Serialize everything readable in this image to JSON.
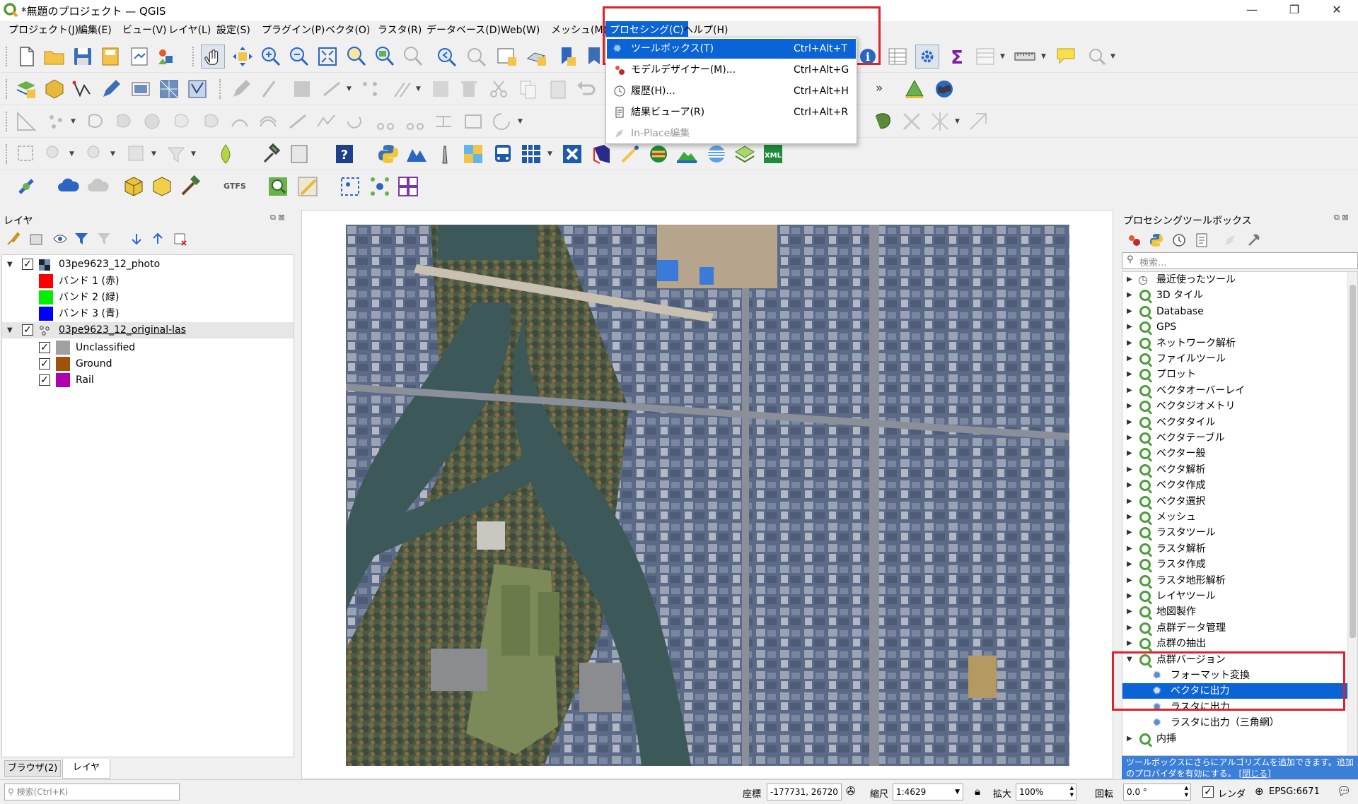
{
  "window": {
    "title": "*無題のプロジェクト — QGIS",
    "minimize": "—",
    "maximize": "❐",
    "close": "✕"
  },
  "menubar": {
    "items": [
      "プロジェクト(J)",
      "編集(E)",
      "ビュー(V)",
      "レイヤ(L)",
      "設定(S)",
      "プラグイン(P)",
      "ベクタ(O)",
      "ラスタ(R)",
      "データベース(D)",
      "Web(W)",
      "メッシュ(M)",
      "プロセシング(C)",
      "ヘルプ(H)"
    ],
    "active": "プロセシング(C)"
  },
  "processing_menu": {
    "items": [
      {
        "label": "ツールボックス(T)",
        "shortcut": "Ctrl+Alt+T",
        "icon": "gear-icon",
        "state": "selected"
      },
      {
        "label": "モデルデザイナー(M)...",
        "shortcut": "Ctrl+Alt+G",
        "icon": "model-designer-icon",
        "state": "normal"
      },
      {
        "label": "履歴(H)...",
        "shortcut": "Ctrl+Alt+H",
        "icon": "clock-icon",
        "state": "normal"
      },
      {
        "label": "結果ビューア(R)",
        "shortcut": "Ctrl+Alt+R",
        "icon": "document-icon",
        "state": "normal"
      },
      {
        "label": "In-Place編集",
        "shortcut": "",
        "icon": "edit-icon",
        "state": "disabled"
      }
    ]
  },
  "toolbar": {
    "more": "»",
    "gtfs": "GTFS",
    "xml": "XML"
  },
  "layers_panel": {
    "title": "レイヤ",
    "layers": [
      {
        "name": "03pe9623_12_photo",
        "checked": true,
        "children": [
          {
            "label": "バンド 1 (赤)",
            "color": "#ff0000"
          },
          {
            "label": "バンド 2 (緑)",
            "color": "#00ee00"
          },
          {
            "label": "バンド 3 (青)",
            "color": "#0000ff"
          }
        ]
      },
      {
        "name": "03pe9623_12_original-las",
        "checked": true,
        "children": [
          {
            "label": "Unclassified",
            "color": "#a0a0a0",
            "checked": true
          },
          {
            "label": "Ground",
            "color": "#a0520a",
            "checked": true
          },
          {
            "label": "Rail",
            "color": "#b000b0",
            "checked": true
          }
        ]
      }
    ],
    "tabs": [
      "ブラウザ(2)",
      "レイヤ"
    ],
    "active_tab": "レイヤ"
  },
  "toolbox_panel": {
    "title": "プロセシングツールボックス",
    "search_placeholder": "検索...",
    "groups": [
      "最近使ったツール",
      "3D タイル",
      "Database",
      "GPS",
      "ネットワーク解析",
      "ファイルツール",
      "プロット",
      "ベクタオーバーレイ",
      "ベクタジオメトリ",
      "ベクタタイル",
      "ベクタテーブル",
      "ベクター般",
      "ベクタ解析",
      "ベクタ作成",
      "ベクタ選択",
      "メッシュ",
      "ラスタツール",
      "ラスタ解析",
      "ラスタ作成",
      "ラスタ地形解析",
      "レイヤツール",
      "地図製作",
      "点群データ管理",
      "点群の抽出",
      "点群バージョン"
    ],
    "expanded_group": "点群バージョン",
    "children": [
      "フォーマット変換",
      "ベクタに出力",
      "ラスタに出力",
      "ラスタに出力（三角網）"
    ],
    "selected": "ベクタに出力",
    "after": [
      "内挿"
    ],
    "notice": "ツールボックスにさらにアルゴリズムを追加できます。追加のプロバイダを有効にする。",
    "notice_link": "[閉じる]"
  },
  "statusbar": {
    "search_placeholder": "検索(Ctrl+K)",
    "coord_label": "座標",
    "coord_value": "-177731, 26720",
    "scale_label": "縮尺",
    "scale_value": "1:4629",
    "magnify_label": "拡大",
    "magnify_value": "100%",
    "rotation_label": "回転",
    "rotation_value": "0.0 °",
    "render_label": "レンダ",
    "crs": "EPSG:6671"
  },
  "colors": {
    "accent": "#0a64d6",
    "highlight_box": "#e0202a",
    "qgis_green": "#4a9e3a"
  }
}
